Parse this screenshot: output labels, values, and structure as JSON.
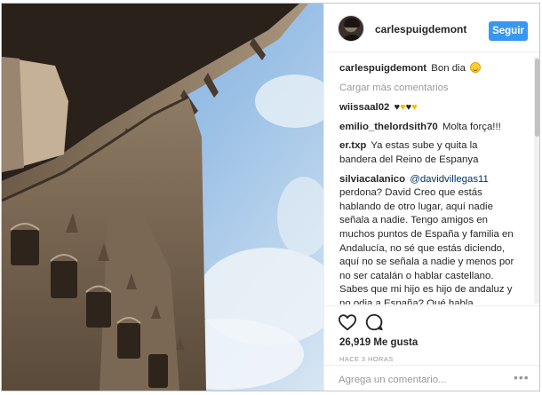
{
  "header": {
    "username": "carlespuigdemont",
    "follow_label": "Seguir"
  },
  "post": {
    "caption_user": "carlespuigdemont",
    "caption_text": "Bon dia",
    "caption_emoji": "smile-emoji",
    "load_more": "Cargar más comentarios"
  },
  "comments": [
    {
      "user": "wiissaal02",
      "text": "♥♥♥♥",
      "hearts": [
        "#262626",
        "#f5b800",
        "#262626",
        "#f5b800"
      ]
    },
    {
      "user": "emilio_thelordsith70",
      "text": "Molta força!!!"
    },
    {
      "user": "er.txp",
      "text": "Ya estas sube y quita la bandera del Reino de Espanya"
    },
    {
      "user": "silviacalanico",
      "mention": "@davidvillegas11",
      "text": "perdona? David Creo que estás hablando de otro lugar, aquí nadie señala a nadie. Tengo amigos en muchos puntos de España y familia en Andalucía, no sé que estás diciendo, aquí no se señala a nadie y menos por no ser catalán o hablar castellano. Sabes que mi hijo es hijo de andaluz y no odia a España? Qué habla perfectamente catalán , castellano y inglés? Que nuestra familia andaluza vive aquí y tiene sus pensamientos y son respetados? No te olvides. Tu en otro luga..."
    }
  ],
  "actions": {
    "like_icon": "heart-outline-icon",
    "comment_icon": "comment-bubble-icon",
    "likes": "26,919 Me gusta",
    "time": "HACE 3 HORAS"
  },
  "add_comment": {
    "placeholder": "Agrega un comentario...",
    "more_icon": "ellipsis-icon"
  },
  "colors": {
    "accent": "#3897f0",
    "text": "#262626",
    "muted": "#999999",
    "sky": "#8fb8e3"
  }
}
